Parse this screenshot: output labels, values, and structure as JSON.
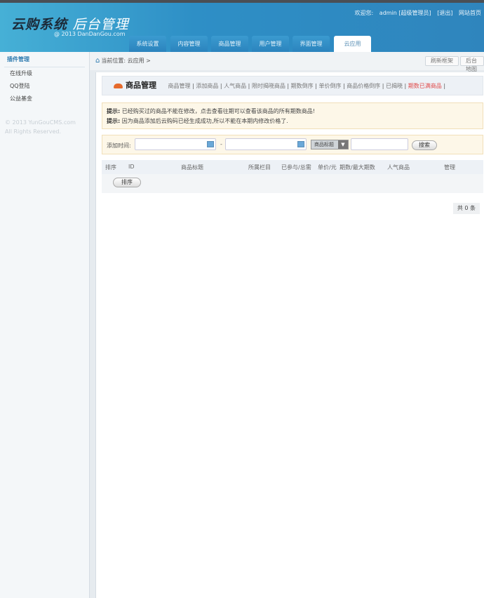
{
  "header": {
    "logo_main": "云购系统",
    "logo_sub": "后台管理",
    "copyright": "@ 2013  DanDanGou.com",
    "welcome": "欢迎您:",
    "user": "admin [超级管理员]",
    "logout": "[退出]",
    "home": "网站首页"
  },
  "tabs": [
    "系统设置",
    "内容管理",
    "商品管理",
    "用户管理",
    "界面管理",
    "云应用"
  ],
  "sidebar": {
    "title": "插件管理",
    "items": [
      "在线升级",
      "QQ登陆",
      "公益基金"
    ],
    "copy1": "© 2013 YunGouCMS.com",
    "copy2": "All Rights Reserved."
  },
  "breadcrumb": {
    "text": "当前位置: 云应用 >",
    "refresh": "刷新框架",
    "backend": "后台地图"
  },
  "panel": {
    "title": "商品管理",
    "links": [
      "商品管理",
      "添加商品",
      "人气商品",
      "限时揭晓商品",
      "期数倒序",
      "单价倒序",
      "商品价格倒序",
      "已揭晓",
      "期数已满商品"
    ]
  },
  "tips": [
    {
      "label": "提示:",
      "text": "已经购买过的商品不能在修改，点击查看往期可以查看该商品的所有期数商品!"
    },
    {
      "label": "提示:",
      "text": "因为商品添加后云购码已经生成成功,所以不能在本期内修改价格了."
    }
  ],
  "search": {
    "label": "添加时间:",
    "dash": "-",
    "select": "商品标题",
    "button": "搜索"
  },
  "table": {
    "headers": [
      "排序",
      "ID",
      "商品标题",
      "所属栏目",
      "已参与/总需",
      "单价/元",
      "期数/最大期数",
      "人气商品",
      "管理"
    ],
    "sort_button": "排序"
  },
  "total": "共 0 条"
}
